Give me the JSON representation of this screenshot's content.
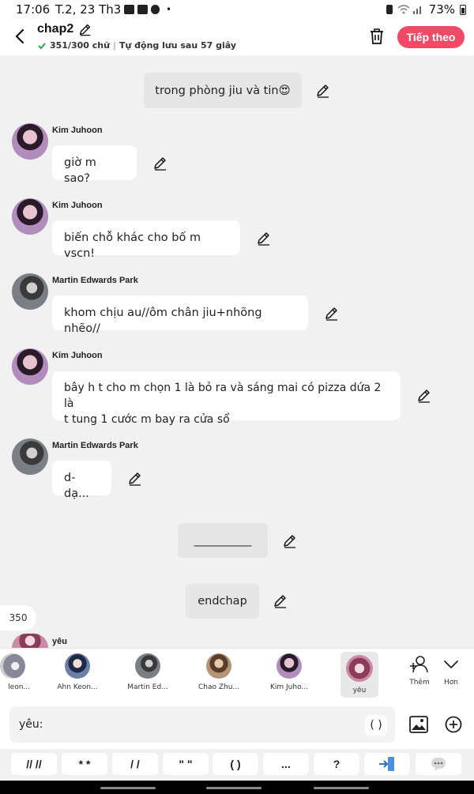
{
  "status": {
    "time": "17:06",
    "date": "T.2, 23 Th3",
    "dot": "•",
    "battery": "73%"
  },
  "header": {
    "title": "chap2",
    "char_count": "351/300 chữ",
    "autosave": "Tự động lưu sau 57 giây",
    "next_label": "Tiếp theo"
  },
  "messages": [
    {
      "type": "narration",
      "text": "trong phòng jiu và tin😍"
    },
    {
      "type": "chat",
      "name": "Kim Juhoon",
      "text": "giờ m sao?"
    },
    {
      "type": "chat",
      "name": "Kim Juhoon",
      "text": "biến chỗ khác cho bố m vscn!"
    },
    {
      "type": "chat",
      "name": "Martin Edwards Park",
      "text": "khom chịu au//ôm chân jiu+nhõng nhẽo//"
    },
    {
      "type": "chat",
      "name": "Kim Juhoon",
      "line1": "bây h t cho m chọn 1 là bỏ ra và sáng mai có pizza dứa 2 là",
      "line2": "t tung 1 cước m bay ra cửa sổ"
    },
    {
      "type": "chat",
      "name": "Martin Edwards Park",
      "text": "d-dạ..."
    },
    {
      "type": "narration",
      "text": "__________"
    },
    {
      "type": "narration",
      "text": "endchap"
    }
  ],
  "count_pill": "350",
  "partial_name": "yêu",
  "characters": [
    {
      "name": "leon..."
    },
    {
      "name": "Ahn Keon..."
    },
    {
      "name": "Martin Ed..."
    },
    {
      "name": "Chao Zhu..."
    },
    {
      "name": "Kim Juho..."
    },
    {
      "name": "yêu",
      "selected": true
    }
  ],
  "tools": {
    "add_label": "Thêm",
    "more_label": "Hơn"
  },
  "input": {
    "value": "yêu:",
    "paren_label": "( )"
  },
  "shortcuts": [
    "// //",
    "* *",
    "/ /",
    "\" \"",
    "( )",
    "...",
    "?"
  ]
}
